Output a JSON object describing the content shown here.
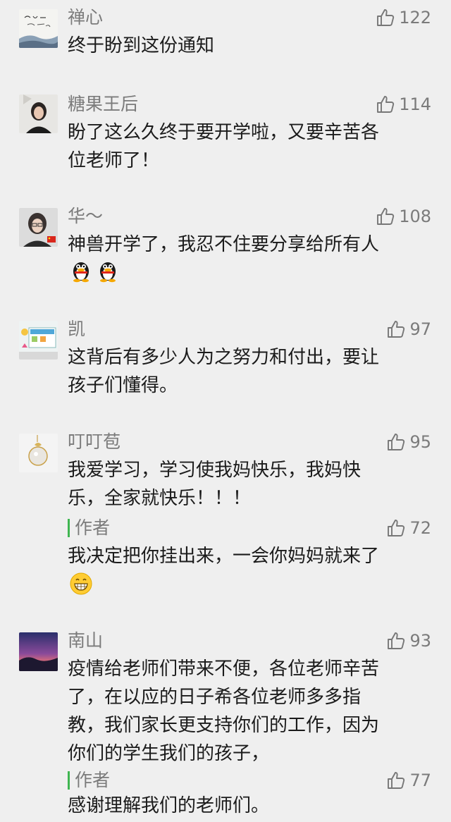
{
  "comments": [
    {
      "name": "禅心",
      "likes": "122",
      "lines": [
        "终于盼到这份通知"
      ]
    },
    {
      "name": "糖果王后",
      "likes": "114",
      "lines": [
        "盼了这么久终于要开学啦，又要辛苦各",
        "位老师了！"
      ]
    },
    {
      "name": "华～",
      "likes": "108",
      "lines": [
        "神兽开学了，我忍不住要分享给所有人"
      ],
      "emojis": [
        "penguin-emoji",
        "penguin-emoji"
      ]
    },
    {
      "name": "凯",
      "likes": "97",
      "lines": [
        "这背后有多少人为之努力和付出，要让",
        "孩子们懂得。"
      ]
    },
    {
      "name": "叮叮苞",
      "likes": "95",
      "lines": [
        "我爱学习，学习使我妈快乐，我妈快",
        "乐，全家就快乐！！！"
      ],
      "reply": {
        "author": "作者",
        "likes": "72",
        "lines": [
          "我决定把你挂出来，一会你妈妈就来了"
        ],
        "emojis": [
          "grin-emoji"
        ]
      }
    },
    {
      "name": "南山",
      "likes": "93",
      "lines": [
        "疫情给老师们带来不便，各位老师辛苦",
        "了，在以应的日子希各位老师多多指",
        "教，我们家长更支持你们的工作，因为",
        "你们的学生我们的孩子，"
      ],
      "reply": {
        "author": "作者",
        "likes": "77",
        "lines": [
          "感谢理解我们的老师们。"
        ]
      }
    }
  ],
  "colors": {
    "author_bar": "#3fb651",
    "meta_text": "#7b7b7b",
    "body_text": "#1b1b1b",
    "background": "#efefef"
  }
}
